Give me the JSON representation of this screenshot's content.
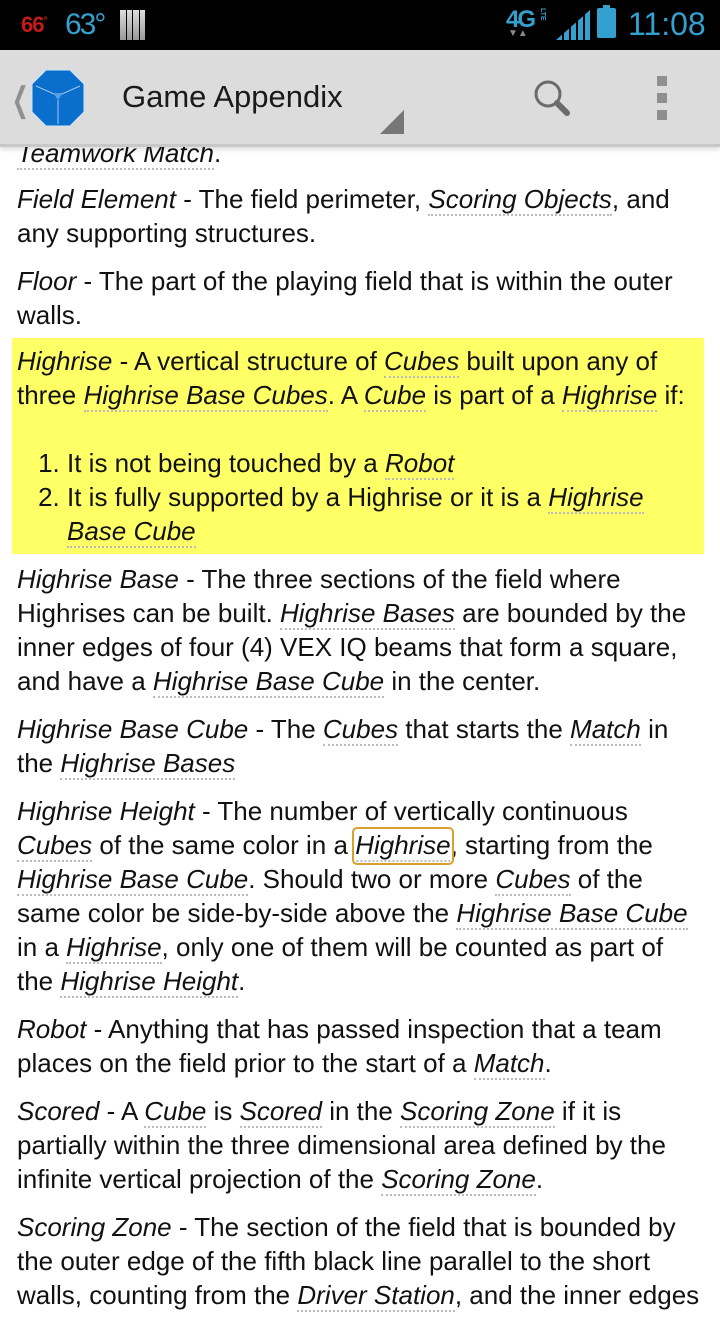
{
  "status_bar": {
    "temp_high": "66",
    "temp_high_unit": "°",
    "temp_current": "63°",
    "network": "4G",
    "network_sub": "LTE",
    "time": "11:08",
    "colors": {
      "accent": "#33a0d0",
      "temp_high": "#c41a1a"
    }
  },
  "action_bar": {
    "title": "Game Appendix",
    "icons": [
      "up-caret-icon",
      "app-logo-cube-icon",
      "spinner-dropdown-icon",
      "search-icon",
      "overflow-menu-icon"
    ]
  },
  "content": {
    "partial_top": {
      "text": "Teamwork Match",
      "suffix": "."
    },
    "entries": [
      {
        "term": "Field Element",
        "parts": [
          " - The field perimeter, ",
          {
            "link": "Scoring Objects"
          },
          ", and any supporting structures."
        ]
      },
      {
        "term": "Floor",
        "parts": [
          " - The part of the playing field that is within the outer walls."
        ]
      },
      {
        "term": "Highrise",
        "highlighted": true,
        "highlight_color": "#ffff66",
        "parts": [
          " - A vertical structure of ",
          {
            "link": "Cubes"
          },
          " built upon any of three ",
          {
            "link": "Highrise Base Cubes"
          },
          ". A ",
          {
            "link": "Cube"
          },
          " is part of a ",
          {
            "link": "Highrise"
          },
          " if:"
        ],
        "list": [
          [
            "It is not being touched by a ",
            {
              "link": "Robot"
            }
          ],
          [
            "It is fully supported by a Highrise or it is a ",
            {
              "link": "Highrise Base Cube"
            }
          ]
        ]
      },
      {
        "term": "Highrise Base",
        "parts": [
          " - The three sections of the field where Highrises can be built. ",
          {
            "link": "Highrise Bases"
          },
          " are bounded by the inner edges of four (4) VEX IQ beams that form a square, and have a ",
          {
            "link": "Highrise Base Cube"
          },
          " in the center."
        ]
      },
      {
        "term": "Highrise Base Cube",
        "parts": [
          " - The ",
          {
            "link": "Cubes"
          },
          " that starts the ",
          {
            "link": "Match"
          },
          " in the ",
          {
            "link": "Highrise Bases"
          }
        ]
      },
      {
        "term": "Highrise Height",
        "parts": [
          " - The number of vertically continuous ",
          {
            "link": "Cubes"
          },
          " of the same color in a ",
          {
            "link": "Highrise",
            "focused": true
          },
          ", starting from the ",
          {
            "link": "Highrise Base Cube"
          },
          ". Should two or more ",
          {
            "link": "Cubes"
          },
          " of the same color be side-by-side above the ",
          {
            "link": "Highrise Base Cube"
          },
          " in a ",
          {
            "link": "Highrise"
          },
          ", only one of them will be counted as part of the ",
          {
            "link": "Highrise Height"
          },
          "."
        ]
      },
      {
        "term": "Robot",
        "parts": [
          " - Anything that has passed inspection that a team places on the field prior to the start of a ",
          {
            "link": "Match"
          },
          "."
        ]
      },
      {
        "term": "Scored",
        "parts": [
          " - A ",
          {
            "link": "Cube"
          },
          " is ",
          {
            "link": "Scored"
          },
          " in the ",
          {
            "link": "Scoring Zone"
          },
          " if it is partially within the three dimensional area defined by the infinite vertical projection of the ",
          {
            "link": "Scoring Zone"
          },
          "."
        ]
      },
      {
        "term": "Scoring Zone",
        "parts": [
          " - The section of the field that is bounded by the outer edge of the fifth black line parallel to the short walls, counting from the ",
          {
            "link": "Driver Station"
          },
          ", and the inner edges"
        ]
      }
    ]
  }
}
